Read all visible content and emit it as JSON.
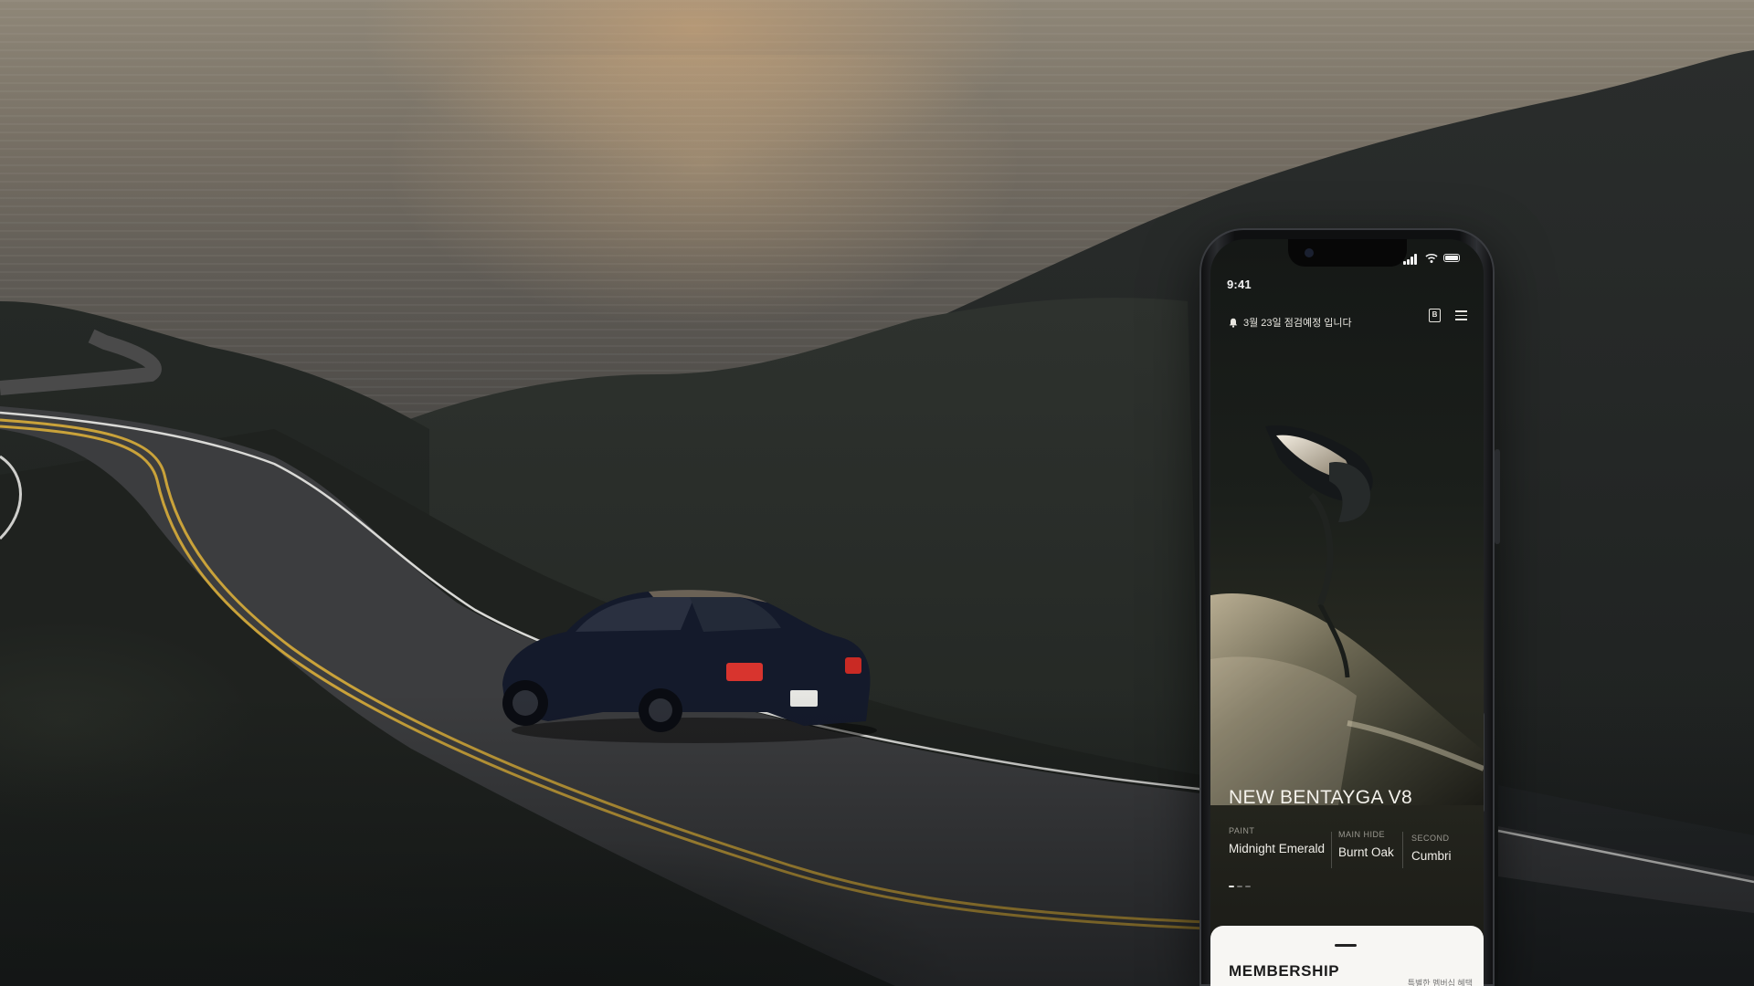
{
  "phone": {
    "status_time": "9:41",
    "notice_text": "3월 23일 점검예정 입니다",
    "icons": {
      "notice": "bell-icon",
      "badge": "b-badge-icon",
      "menu": "menu-icon",
      "signal": "signal-icon",
      "wifi": "wifi-icon",
      "battery": "battery-icon"
    },
    "badge_letter": "B",
    "model_name": "NEW BENTAYGA V8",
    "specs": [
      {
        "label": "PAINT",
        "value": "Midnight Emerald"
      },
      {
        "label": "MAIN HIDE",
        "value": "Burnt Oak"
      },
      {
        "label": "SECOND",
        "value": "Cumbri"
      }
    ],
    "pager_active": 0,
    "pager_total": 3,
    "membership": {
      "title": "MEMBERSHIP",
      "subtitle": "특별한 멤버십 혜택"
    }
  },
  "colors": {
    "screen_bg": "#151816",
    "sheet_bg": "#f7f6f3",
    "text_light": "#f4f2ec",
    "road_line": "#c9a23a"
  }
}
